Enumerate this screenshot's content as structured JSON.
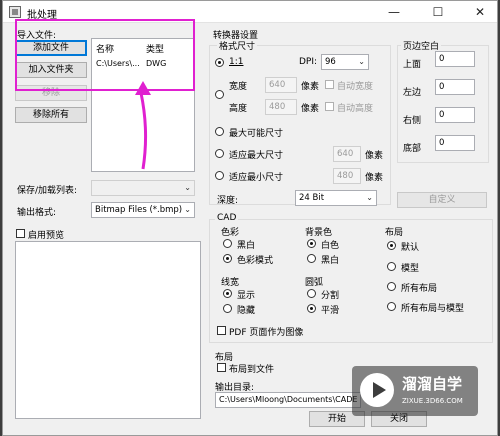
{
  "window": {
    "title": "批处理",
    "minimize": "—",
    "maximize": "☐",
    "close": "✕"
  },
  "import": {
    "label": "导入文件:",
    "add_file": "添加文件",
    "add_folder": "加入文件夹",
    "remove": "移除",
    "remove_all": "移除所有",
    "columns": [
      "名称",
      "类型"
    ],
    "rows": [
      {
        "name": "C:\\Users\\...",
        "type": "DWG"
      }
    ]
  },
  "left": {
    "save_load_label": "保存/加载列表:",
    "output_format_label": "输出格式:",
    "output_format_value": "Bitmap Files (*.bmp)",
    "preview_label": "启用预览"
  },
  "converter": {
    "title": "转换器设置",
    "format_size": "格式尺寸",
    "one_to_one": "1:1",
    "dpi_label": "DPI:",
    "dpi_value": "96",
    "width_label": "宽度",
    "width_value": "640",
    "height_label": "高度",
    "height_value": "480",
    "pixel": "像素",
    "auto_width": "自动宽度",
    "auto_height": "自动高度",
    "max_possible": "最大可能尺寸",
    "fit_max": "适应最大尺寸",
    "fit_max_value": "640",
    "fit_min": "适应最小尺寸",
    "fit_min_value": "480",
    "depth_label": "深度:",
    "depth_value": "24 Bit",
    "custom_button": "自定义"
  },
  "margins": {
    "title": "页边空白",
    "top_label": "上面",
    "top_value": "0",
    "left_label": "左边",
    "left_value": "0",
    "right_label": "右侧",
    "right_value": "0",
    "bottom_label": "底部",
    "bottom_value": "0"
  },
  "cad": {
    "title": "CAD",
    "color_title": "色彩",
    "bw": "黑白",
    "color_mode": "色彩模式",
    "bg_title": "背景色",
    "white": "白色",
    "black": "黑白",
    "layout_title": "布局",
    "default": "默认",
    "model": "模型",
    "all_layouts": "所有布局",
    "all_layouts_model": "所有布局与模型",
    "lineweight_title": "线宽",
    "show": "显示",
    "hide": "隐藏",
    "arc_title": "圆弧",
    "split": "分割",
    "smooth": "平滑",
    "pdf_pages": "PDF 页面作为图像"
  },
  "layout": {
    "title": "布局",
    "to_file": "布局到文件"
  },
  "output": {
    "dir_label": "输出目录:",
    "dir_value": "C:\\Users\\Mloong\\Documents\\CADE",
    "start_button": "开始",
    "close_button": "关闭"
  },
  "watermark": {
    "brand": "溜溜自学",
    "url": "ZIXUE.3D66.COM"
  },
  "colors": {
    "highlight": "#e020d0",
    "focus": "#0078d7"
  }
}
